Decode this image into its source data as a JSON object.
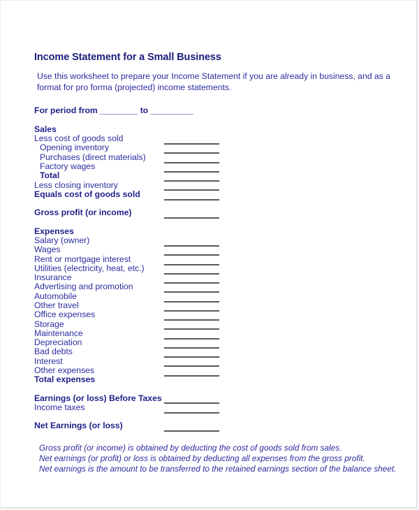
{
  "document": {
    "title": "Income Statement for a Small Business",
    "intro": "Use this worksheet to prepare your Income Statement if you are already in business, and as a format for pro forma (projected) income statements.",
    "period_label": "For period from ________ to _________"
  },
  "sales_section": {
    "heading": "Sales",
    "less_cogs": "Less cost of goods sold",
    "opening_inventory": "Opening inventory",
    "purchases": "Purchases (direct materials)",
    "factory_wages": "Factory wages",
    "total": "Total",
    "less_closing_inventory": "Less closing inventory",
    "equals_cogs": "Equals cost of goods sold"
  },
  "gross_profit": "Gross profit (or income)",
  "expenses_section": {
    "heading": "Expenses",
    "items": [
      "Salary (owner)",
      "Wages",
      "Rent or mortgage interest",
      "Utilities (electricity, heat, etc.)",
      "Insurance",
      "Advertising and promotion",
      "Automobile",
      "Other travel",
      "Office expenses",
      "Storage",
      "Maintenance",
      "Depreciation",
      "Bad debts",
      "Interest",
      "Other expenses"
    ],
    "total": "Total expenses"
  },
  "earnings_before_taxes": "Earnings (or loss) Before Taxes",
  "income_taxes": "Income taxes",
  "net_earnings": "Net Earnings (or loss)",
  "notes": [
    "Gross profit (or income) is obtained by deducting the cost of goods sold from sales.",
    "Net earnings (or profit) or loss is obtained by deducting all expenses from the gross profit.",
    "Net earnings is the amount to be transferred to the retained earnings section of the balance sheet."
  ],
  "colors": {
    "title": "#1c1c7c",
    "body_text": "#2b2ba0",
    "blank_line": "#5a5a5a"
  }
}
